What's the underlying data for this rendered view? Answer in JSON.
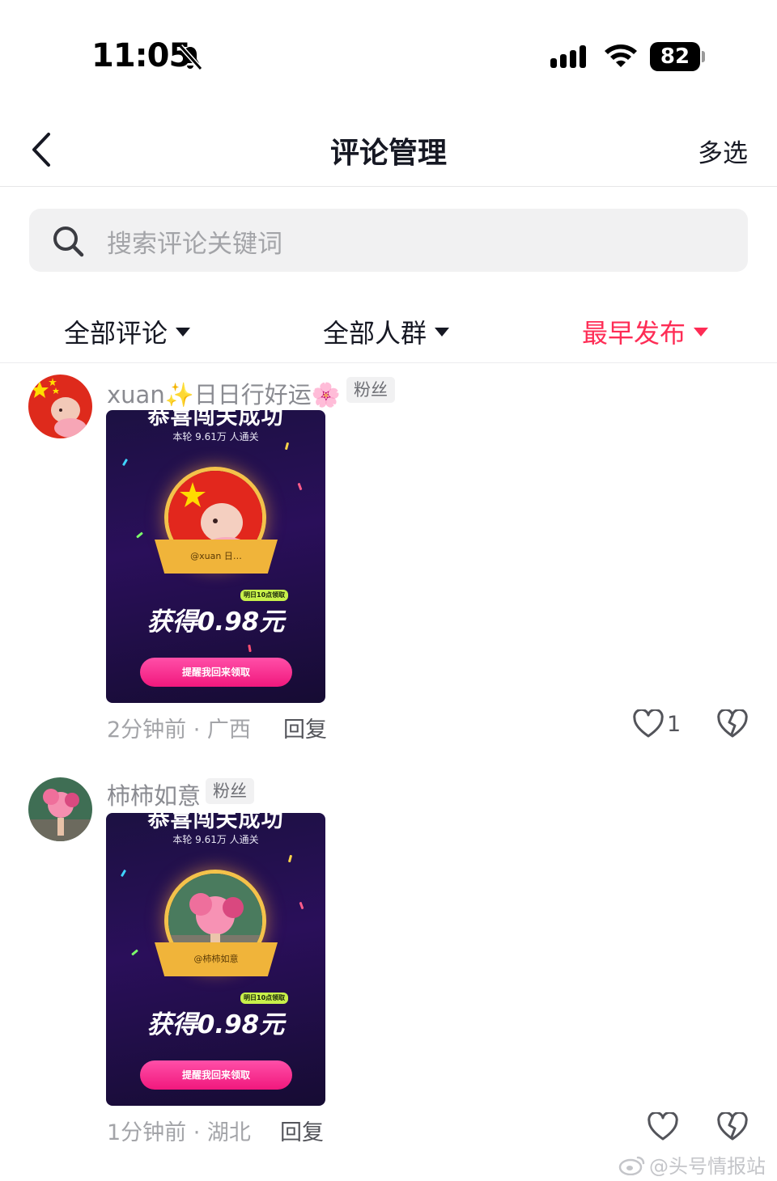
{
  "status_bar": {
    "time": "11:05",
    "battery": "82"
  },
  "nav": {
    "title": "评论管理",
    "multi_select": "多选"
  },
  "search": {
    "placeholder": "搜索评论关键词"
  },
  "filters": [
    {
      "label": "全部评论",
      "active": false
    },
    {
      "label": "全部人群",
      "active": false
    },
    {
      "label": "最早发布",
      "active": true
    }
  ],
  "comments": [
    {
      "user": "xuan✨日日行好运🌸",
      "badge": "粉丝",
      "image": {
        "title": "恭喜闯关成功",
        "subtitle": "本轮 9.61万 人通关",
        "ribbon": "@xuan    日…",
        "tag": "明日10点领取",
        "amount": "获得0.98元",
        "button": "提醒我回来领取"
      },
      "time_location": "2分钟前 · 广西",
      "reply": "回复",
      "likes": "1"
    },
    {
      "user": "柿柿如意",
      "badge": "粉丝",
      "image": {
        "title": "恭喜闯关成功",
        "subtitle": "本轮 9.61万 人通关",
        "ribbon": "@柿柿如意",
        "tag": "明日10点领取",
        "amount": "获得0.98元",
        "button": "提醒我回来领取"
      },
      "time_location": "1分钟前 · 湖北",
      "reply": "回复",
      "likes": ""
    }
  ],
  "watermark": "@头号情报站",
  "colors": {
    "accent": "#fe2c55",
    "text": "#161823",
    "muted": "#a3a4a8"
  }
}
